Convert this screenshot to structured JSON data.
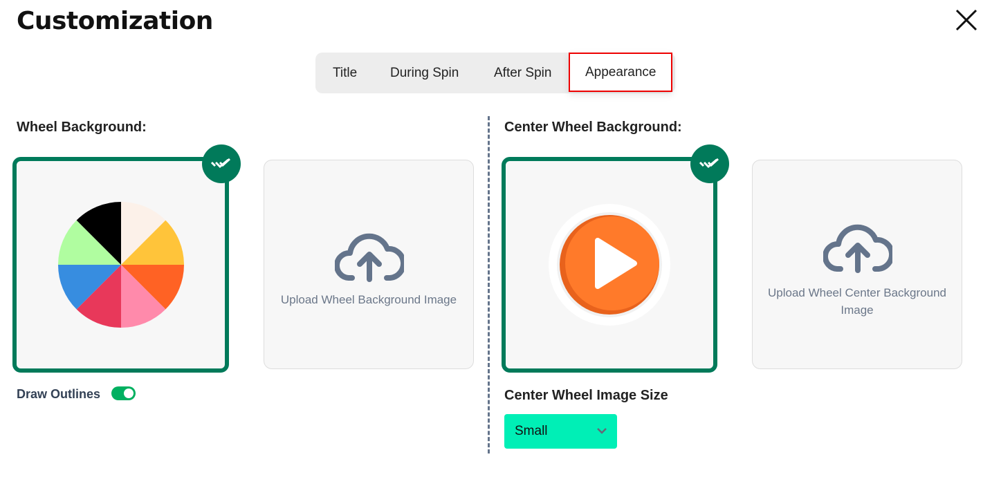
{
  "title": "Customization",
  "tabs": [
    {
      "label": "Title"
    },
    {
      "label": "During Spin"
    },
    {
      "label": "After Spin"
    },
    {
      "label": "Appearance",
      "active": true
    }
  ],
  "wheel_background": {
    "label": "Wheel Background:",
    "upload_label": "Upload Wheel Background Image",
    "draw_outlines_label": "Draw Outlines",
    "draw_outlines_on": true,
    "wheel_colors": [
      "#fcf1e9",
      "#ffc43a",
      "#ff6224",
      "#ff8aab",
      "#e8385a",
      "#378de0",
      "#b0fda0",
      "#000000"
    ]
  },
  "center_background": {
    "label": "Center Wheel Background:",
    "upload_label": "Upload Wheel Center Background Image"
  },
  "center_size": {
    "label": "Center Wheel Image Size",
    "value": "Small"
  },
  "colors": {
    "selected": "#017a5a",
    "toggle": "#00b060",
    "dropdown": "#00efb6"
  }
}
